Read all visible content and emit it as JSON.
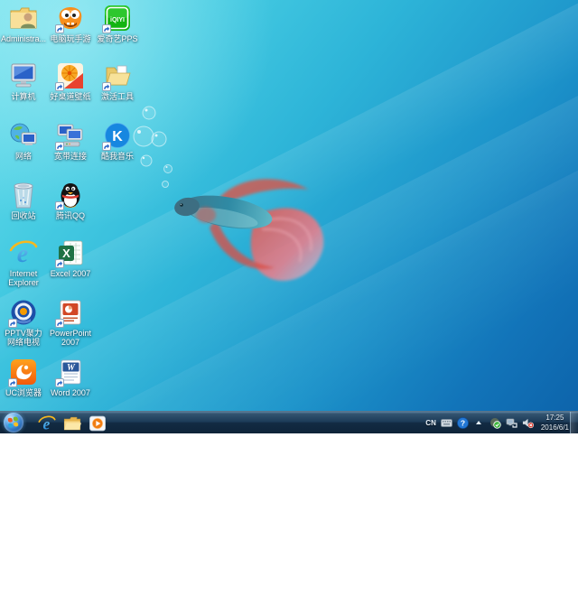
{
  "desktop": {
    "icons": [
      {
        "label": "Administra...",
        "icon": "user-folder",
        "shortcut": false
      },
      {
        "label": "电脑玩手游",
        "icon": "orange-monster",
        "shortcut": true
      },
      {
        "label": "爱奇艺PPS",
        "icon": "iqiyi",
        "shortcut": true
      },
      {
        "label": "计算机",
        "icon": "computer",
        "shortcut": false
      },
      {
        "label": "好桌道壁纸",
        "icon": "tangerine-wallpaper",
        "shortcut": true
      },
      {
        "label": "激活工具",
        "icon": "open-folder",
        "shortcut": true
      },
      {
        "label": "网络",
        "icon": "network-globe",
        "shortcut": false
      },
      {
        "label": "宽带连接",
        "icon": "broadband",
        "shortcut": true
      },
      {
        "label": "酷我音乐",
        "icon": "kuwo-music",
        "shortcut": true
      },
      {
        "label": "回收站",
        "icon": "recycle-bin",
        "shortcut": false
      },
      {
        "label": "腾讯QQ",
        "icon": "qq-penguin",
        "shortcut": true
      },
      {
        "label": "Internet Explorer",
        "icon": "internet-explorer",
        "shortcut": false
      },
      {
        "label": "Excel 2007",
        "icon": "excel",
        "shortcut": true
      },
      {
        "label": "PPTV聚力 网络电视",
        "icon": "pptv",
        "shortcut": true
      },
      {
        "label": "PowerPoint 2007",
        "icon": "powerpoint",
        "shortcut": true
      },
      {
        "label": "UC浏览器",
        "icon": "uc-browser",
        "shortcut": true
      },
      {
        "label": "Word 2007",
        "icon": "word",
        "shortcut": true
      }
    ]
  },
  "taskbar": {
    "pinned": [
      "internet-explorer",
      "windows-explorer",
      "windows-media-player"
    ],
    "tray": {
      "language": "CN",
      "time": "17:25",
      "date": "2016/6/1"
    }
  },
  "icon_glyphs": {
    "ie_letter": "e",
    "excel_letter": "X",
    "word_letter": "W",
    "kuwo_letter": "K",
    "iqiyi_text": "iQIYI",
    "help_glyph": "?"
  },
  "colors": {
    "wallpaper_top": "#6ee0ec",
    "wallpaper_bottom": "#0d64ab",
    "taskbar": "#1d3c59",
    "iqiyi_green": "#12b412",
    "kuwo_blue": "#1787e0",
    "uc_orange": "#f97316",
    "qq_scarf_red": "#e03c31",
    "ie_blue": "#2a9de0",
    "excel_green": "#1f7145",
    "word_blue": "#2b579a",
    "powerpoint_red": "#d24726",
    "pptv_blue": "#1d4fa8",
    "volume_muted_red": "#d83a2e"
  }
}
